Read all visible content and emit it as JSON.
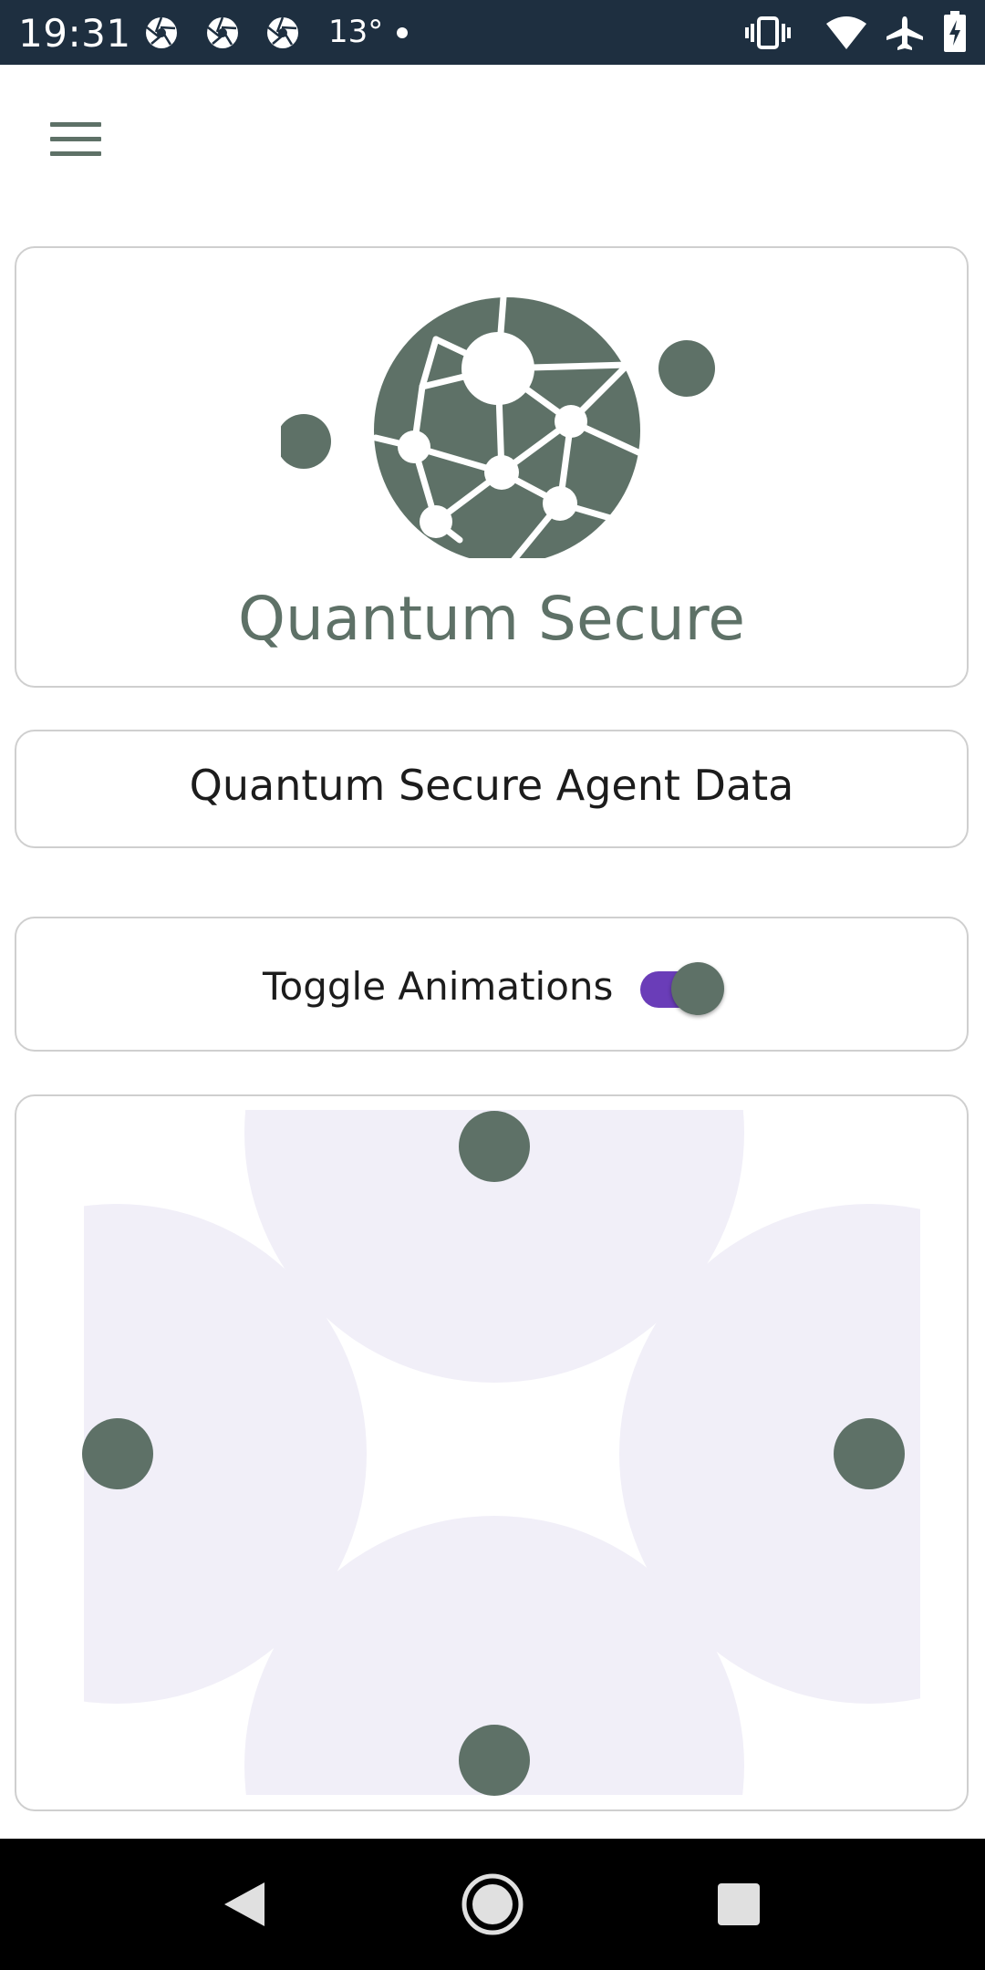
{
  "status_bar": {
    "time": "19:31",
    "temperature": "13°",
    "icons": [
      "camera-aperture-icon",
      "camera-aperture-icon",
      "camera-aperture-icon",
      "notification-dot-icon",
      "vibrate-icon",
      "wifi-icon",
      "airplane-mode-icon",
      "battery-icon"
    ]
  },
  "app": {
    "title": "Quantum Secure",
    "agent_data_label": "Quantum Secure Agent Data",
    "toggle_label": "Toggle Animations",
    "toggle_on": true
  },
  "colors": {
    "brand": "#5e7167",
    "accent": "#6a3db8",
    "status_bar": "#1e2f40",
    "animation_tint": "#f1eff8"
  },
  "nav_bar": {
    "buttons": [
      "back-icon",
      "home-icon",
      "recents-icon"
    ]
  }
}
